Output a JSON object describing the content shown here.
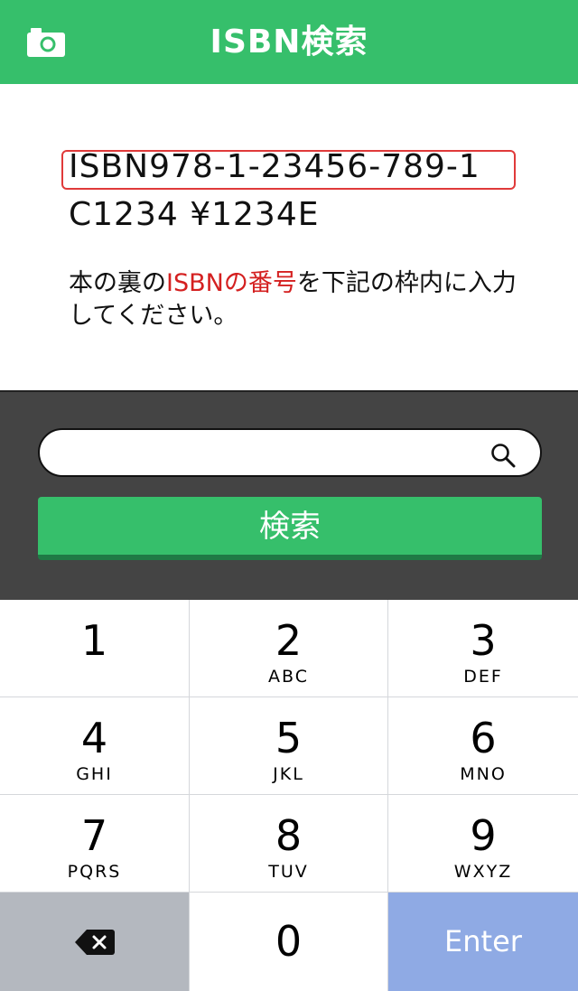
{
  "header": {
    "title": "ISBN検索",
    "camera_icon": "camera-icon",
    "bg_color": "#36bf6b"
  },
  "info": {
    "isbn_example": "ISBN978-1-23456-789-1",
    "code_example": "C1234 ¥1234E",
    "instruction_prefix": "本の裏の",
    "instruction_highlight": "ISBNの番号",
    "instruction_suffix": "を下記の枠内に入力してください。",
    "highlight_color": "#d42020"
  },
  "search": {
    "input_value": "",
    "input_placeholder": "",
    "search_icon": "search-icon",
    "button_label": "検索"
  },
  "keypad": {
    "keys": [
      {
        "num": "1",
        "letters": ""
      },
      {
        "num": "2",
        "letters": "ABC"
      },
      {
        "num": "3",
        "letters": "DEF"
      },
      {
        "num": "4",
        "letters": "GHI"
      },
      {
        "num": "5",
        "letters": "JKL"
      },
      {
        "num": "6",
        "letters": "MNO"
      },
      {
        "num": "7",
        "letters": "PQRS"
      },
      {
        "num": "8",
        "letters": "TUV"
      },
      {
        "num": "9",
        "letters": "WXYZ"
      }
    ],
    "zero": "0",
    "enter_label": "Enter",
    "delete_icon": "backspace-icon",
    "enter_color": "#8faae4"
  }
}
